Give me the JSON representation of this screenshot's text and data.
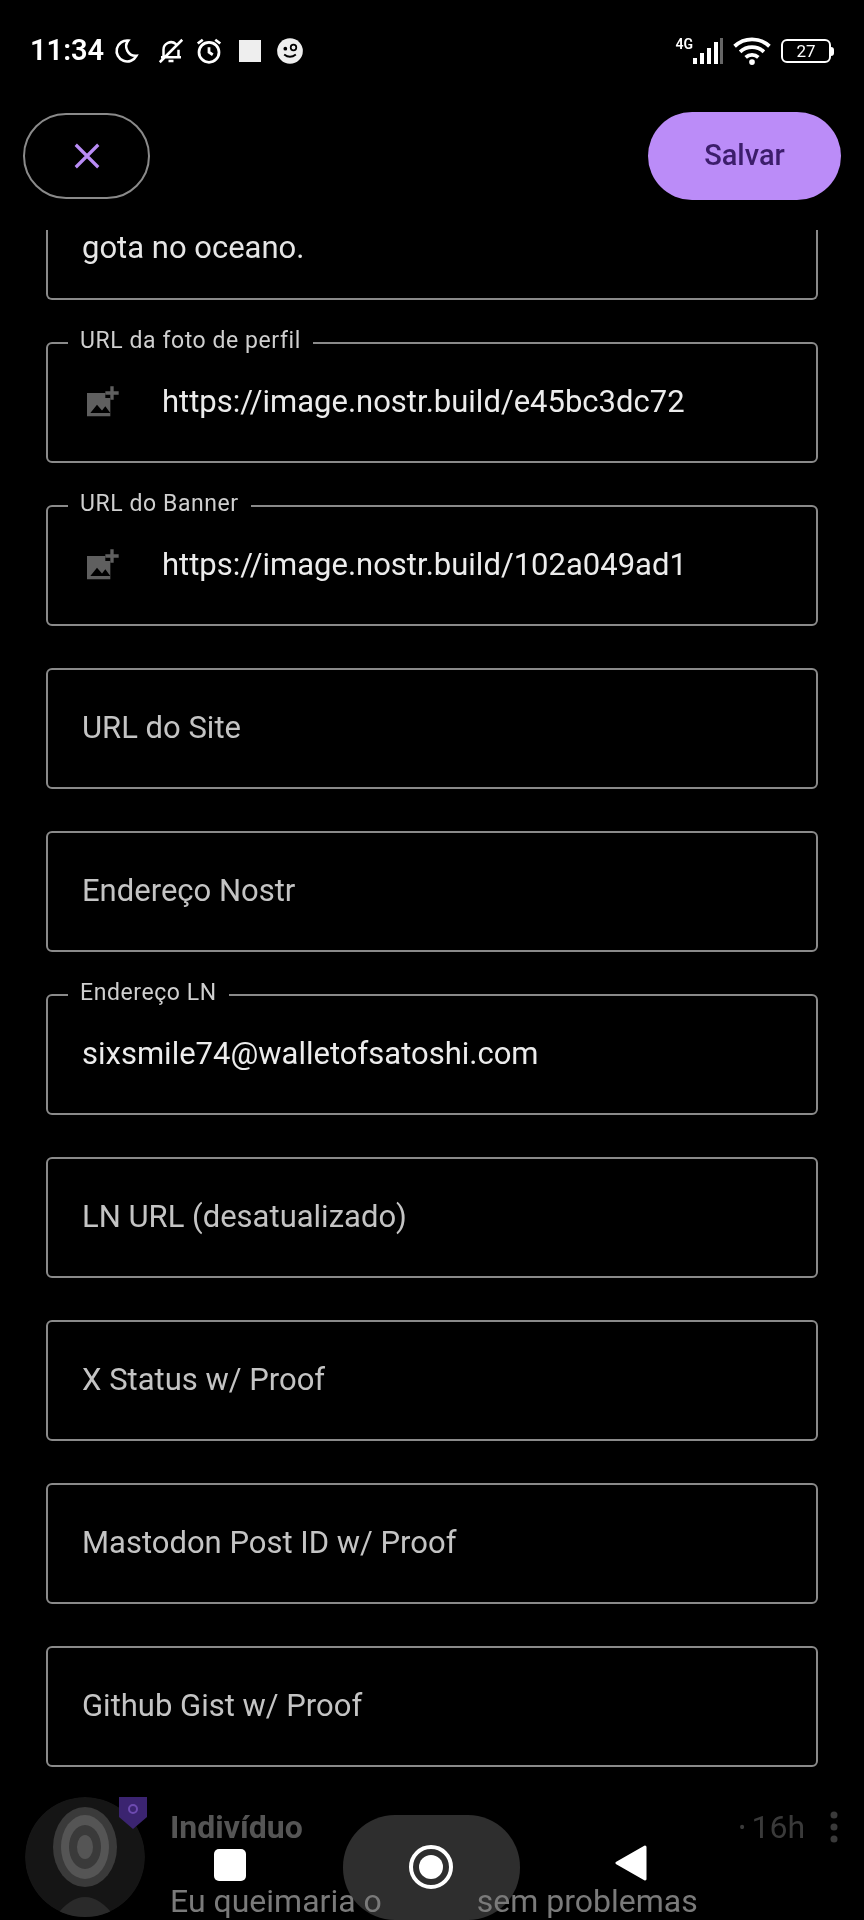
{
  "status_bar": {
    "time": "11:34",
    "network": "4G",
    "battery": "27"
  },
  "header": {
    "save_label": "Salvar"
  },
  "fields": [
    {
      "kind": "partial",
      "value": "gota no oceano."
    },
    {
      "kind": "image_url",
      "label": "URL da foto de perfil",
      "value": "https://image.nostr.build/e45bc3dc72"
    },
    {
      "kind": "image_url",
      "label": "URL do Banner",
      "value": "https://image.nostr.build/102a049ad1"
    },
    {
      "kind": "text",
      "placeholder": "URL do Site"
    },
    {
      "kind": "text",
      "placeholder": "Endereço Nostr"
    },
    {
      "kind": "text",
      "label": "Endereço LN",
      "value": "sixsmile74@walletofsatoshi.com"
    },
    {
      "kind": "text",
      "placeholder": "LN URL (desatualizado)"
    },
    {
      "kind": "text",
      "placeholder": "X Status w/ Proof"
    },
    {
      "kind": "text",
      "placeholder": "Mastodon Post ID w/ Proof"
    },
    {
      "kind": "text",
      "placeholder": "Github Gist w/ Proof"
    }
  ],
  "feed_item": {
    "name": "Indivíduo",
    "separator": "•",
    "time": "16h",
    "text_parts": [
      "Eu queimaria o",
      "sem problemas"
    ]
  }
}
